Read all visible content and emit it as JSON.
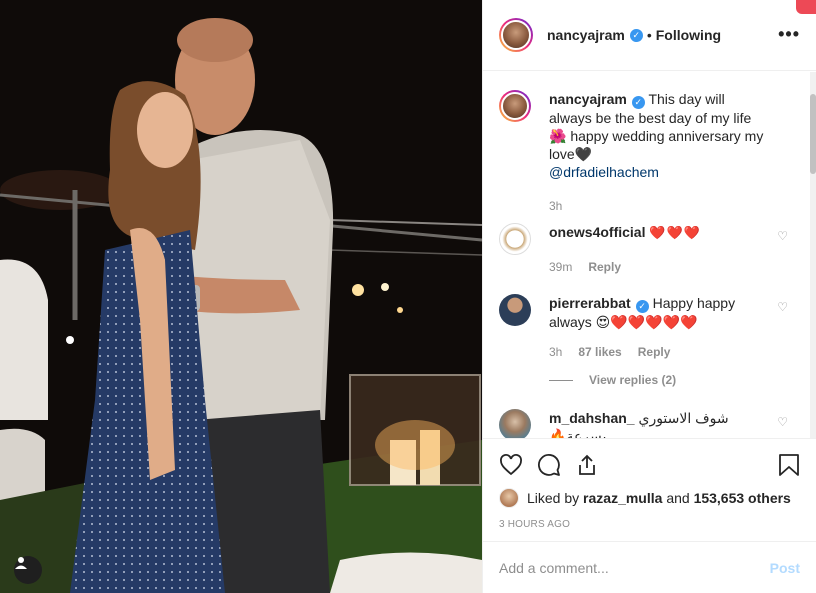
{
  "post": {
    "username": "nancyajram",
    "follow_status": "Following",
    "separator": "•",
    "more": "•••"
  },
  "caption": {
    "username": "nancyajram",
    "text": "This day will always be the best day of my life 🌺 happy wedding anniversary my love🖤",
    "mention": "@drfadielhachem",
    "time": "3h"
  },
  "comments": [
    {
      "username": "onews4official",
      "text": "❤️❤️❤️",
      "time": "39m",
      "reply": "Reply"
    },
    {
      "username": "pierrerabbat",
      "text": "Happy happy always 😍❤️❤️❤️❤️❤️",
      "time": "3h",
      "likes": "87 likes",
      "reply": "Reply",
      "view_replies": "View replies (2)"
    },
    {
      "username": "m_dahshan_",
      "text": "شوف الاستوري بسرعة🔥"
    }
  ],
  "likes": {
    "prefix": "Liked by",
    "user": "razaz_mulla",
    "middle": "and",
    "count": "153,653 others"
  },
  "timestamp": "3 HOURS AGO",
  "add_comment": {
    "placeholder": "Add a comment...",
    "post_label": "Post"
  },
  "colors": {
    "verified": "#3897f0",
    "heart": "#ed4956",
    "post_disabled": "#b3dbff"
  },
  "icons": [
    "heart-icon",
    "comment-icon",
    "share-icon",
    "bookmark-icon",
    "user-tag-icon",
    "verified-icon"
  ]
}
